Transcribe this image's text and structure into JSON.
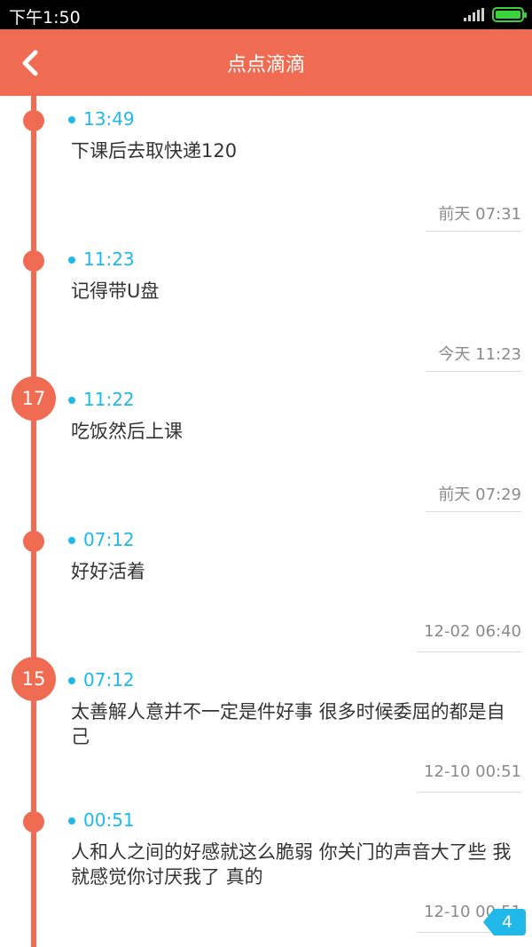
{
  "status_bar": {
    "time": "下午1:50"
  },
  "app_bar": {
    "title": "点点滴滴"
  },
  "entries": [
    {
      "day_label": "",
      "time": "13:49",
      "text": "下课后去取快递120",
      "date": "前天 07:31"
    },
    {
      "day_label": "",
      "time": "11:23",
      "text": "记得带U盘",
      "date": "今天 11:23"
    },
    {
      "day_label": "17",
      "time": "11:22",
      "text": "吃饭然后上课",
      "date": "前天 07:29"
    },
    {
      "day_label": "",
      "time": "07:12",
      "text": "好好活着",
      "date": "12-02 06:40"
    },
    {
      "day_label": "15",
      "time": "07:12",
      "text": "太善解人意并不一定是件好事 很多时候委屈的都是自己",
      "date": "12-10 00:51"
    },
    {
      "day_label": "",
      "time": "00:51",
      "text": "人和人之间的好感就这么脆弱 你关门的声音大了些 我就感觉你讨厌我了 真的",
      "date": "12-10 00:51"
    }
  ],
  "unread_count": "4",
  "colors": {
    "accent": "#ef6c52",
    "time_blue": "#1fb8e8",
    "text": "#333333",
    "muted": "#8a8a8a"
  }
}
